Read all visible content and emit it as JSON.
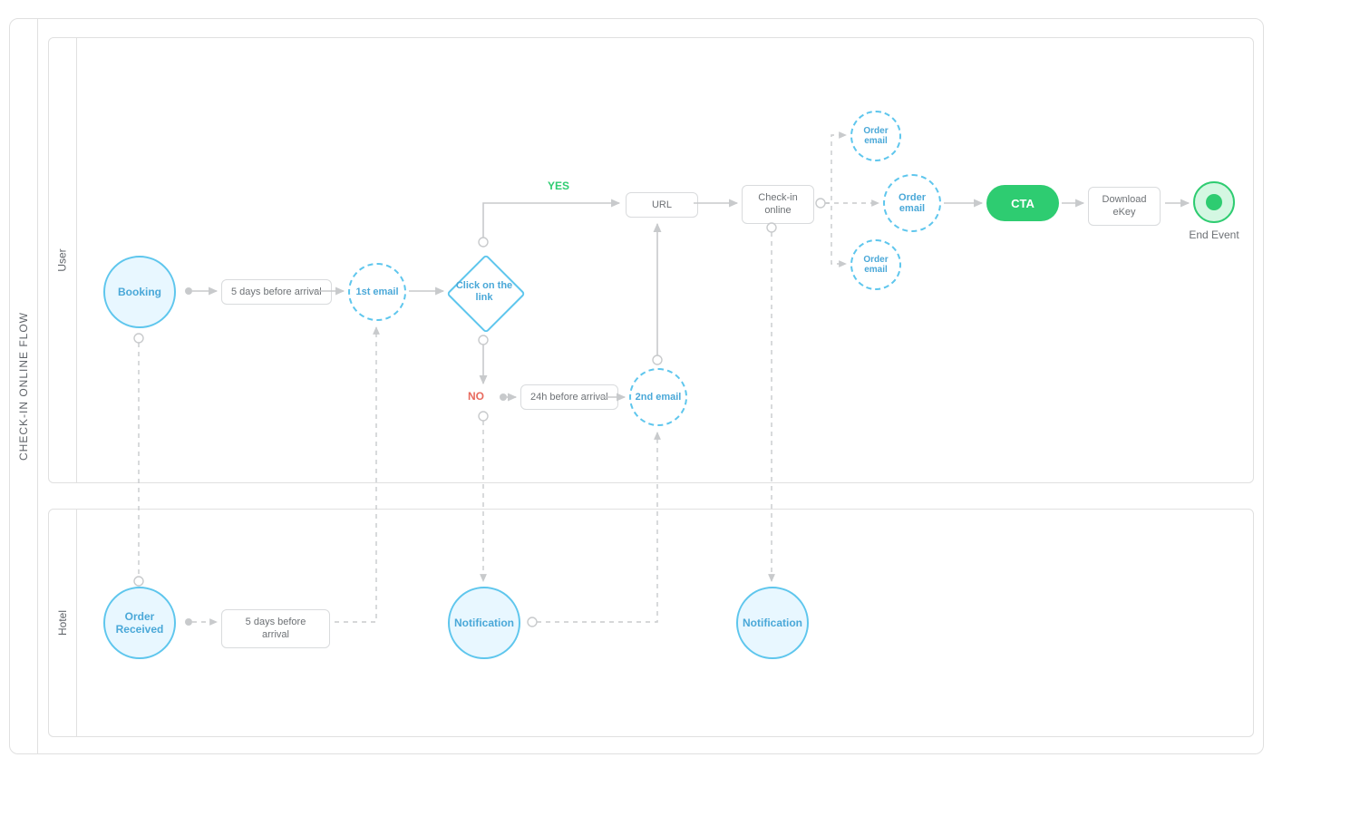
{
  "pool_title": "CHECK-IN ONLINE FLOW",
  "lanes": {
    "user": "User",
    "hotel": "Hotel"
  },
  "user": {
    "booking": "Booking",
    "wait1": "5 days before arrival",
    "email1": "1st email",
    "decision": "Click on the link",
    "yes": "YES",
    "no": "NO",
    "wait2": "24h before arrival",
    "email2": "2nd email",
    "url": "URL",
    "checkin": "Check-in online",
    "order_email": "Order email",
    "cta": "CTA",
    "download": "Download eKey",
    "end_label": "End Event"
  },
  "hotel": {
    "order_received": "Order Received",
    "wait1": "5 days before arrival",
    "notification": "Notification"
  }
}
